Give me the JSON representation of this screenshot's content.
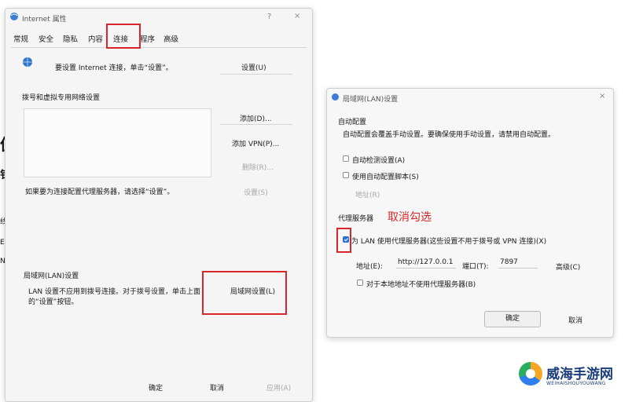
{
  "left_edge": [
    "值",
    "钅",
    "线",
    "E",
    "N"
  ],
  "internet_props": {
    "title": "Internet 属性",
    "help_glyph": "?",
    "close_glyph": "×",
    "tabs": [
      "常规",
      "安全",
      "隐私",
      "内容",
      "连接",
      "程序",
      "高级"
    ],
    "setup_text": "要设置 Internet 连接，单击“设置”。",
    "setup_button": "设置(U)",
    "dial_section_label": "拨号和虚拟专用网络设置",
    "add_button": "添加(D)...",
    "add_vpn_button": "添加 VPN(P)...",
    "remove_button": "删除(R)...",
    "settings_button": "设置(S)",
    "proxy_hint": "如果要为连接配置代理服务器，请选择“设置”。",
    "lan_section_label": "局域网(LAN)设置",
    "lan_desc_line1": "LAN 设置不应用到拨号连接。对于拨号设置，单击上面",
    "lan_desc_line2": "的“设置”按钮。",
    "lan_settings_button": "局域网设置(L)",
    "ok": "确定",
    "cancel": "取消",
    "apply": "应用(A)"
  },
  "lan_dialog": {
    "title": "局域网(LAN)设置",
    "close_glyph": "×",
    "auto_config_label": "自动配置",
    "auto_config_desc": "自动配置会覆盖手动设置。要确保使用手动设置，请禁用自动配置。",
    "auto_detect": "自动检测设置(A)",
    "use_script": "使用自动配置脚本(S)",
    "address_disabled": "地址(R)",
    "proxy_label": "代理服务器",
    "annotation": "取消勾选",
    "use_proxy": "为 LAN 使用代理服务器(这些设置不用于拨号或 VPN 连接)(X)",
    "address_label": "地址(E):",
    "address_value": "http://127.0.0.1",
    "port_label": "端口(T):",
    "port_value": "7897",
    "advanced": "高级(C)",
    "bypass_local": "对于本地地址不使用代理服务器(B)",
    "ok": "确定",
    "cancel": "取消"
  },
  "watermark": {
    "title": "威海手游网",
    "subtitle": "WEIHAISHOUYOUWANG"
  },
  "colors": {
    "highlight_red": "#d9262b",
    "checkbox_blue": "#2a6fd6",
    "logo_text": "#1b3c7a"
  }
}
